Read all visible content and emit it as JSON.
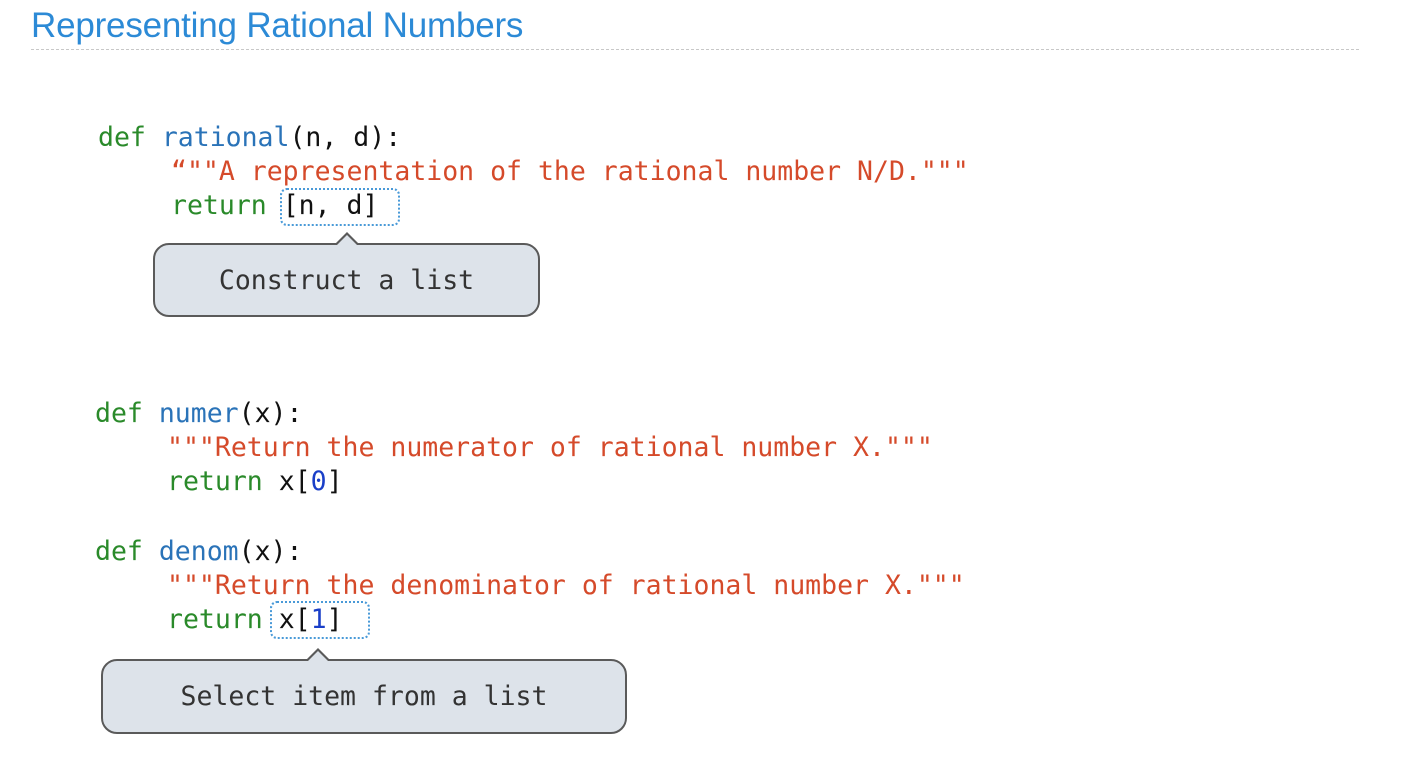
{
  "slide": {
    "title": "Representing Rational Numbers"
  },
  "code": {
    "rational": {
      "def": "def ",
      "name": "rational",
      "sig": "(n, d):",
      "doc": "“\"\"A representation of the rational number N/D.\"\"\"",
      "ret_kw": "return ",
      "ret_expr": "[n, d]"
    },
    "numer": {
      "def": "def ",
      "name": "numer",
      "sig": "(x):",
      "doc": "\"\"\"Return the numerator of rational number X.\"\"\"",
      "ret_kw": "return ",
      "ret_pre": "x[",
      "ret_num": "0",
      "ret_post": "]"
    },
    "denom": {
      "def": "def ",
      "name": "denom",
      "sig": "(x):",
      "doc": "\"\"\"Return the denominator of rational number X.\"\"\"",
      "ret_kw": "return ",
      "ret_pre": "x[",
      "ret_num": "1",
      "ret_post": "]"
    }
  },
  "callouts": {
    "construct": "Construct a list",
    "select": "Select item from a list"
  },
  "colors": {
    "title": "#2c8ad6",
    "keyword": "#2a8a2a",
    "function_name": "#2a73b8",
    "string": "#d54a2a",
    "number": "#1a3fc8",
    "callout_bg": "#dde3ea",
    "highlight_border": "#4a9ad8"
  }
}
